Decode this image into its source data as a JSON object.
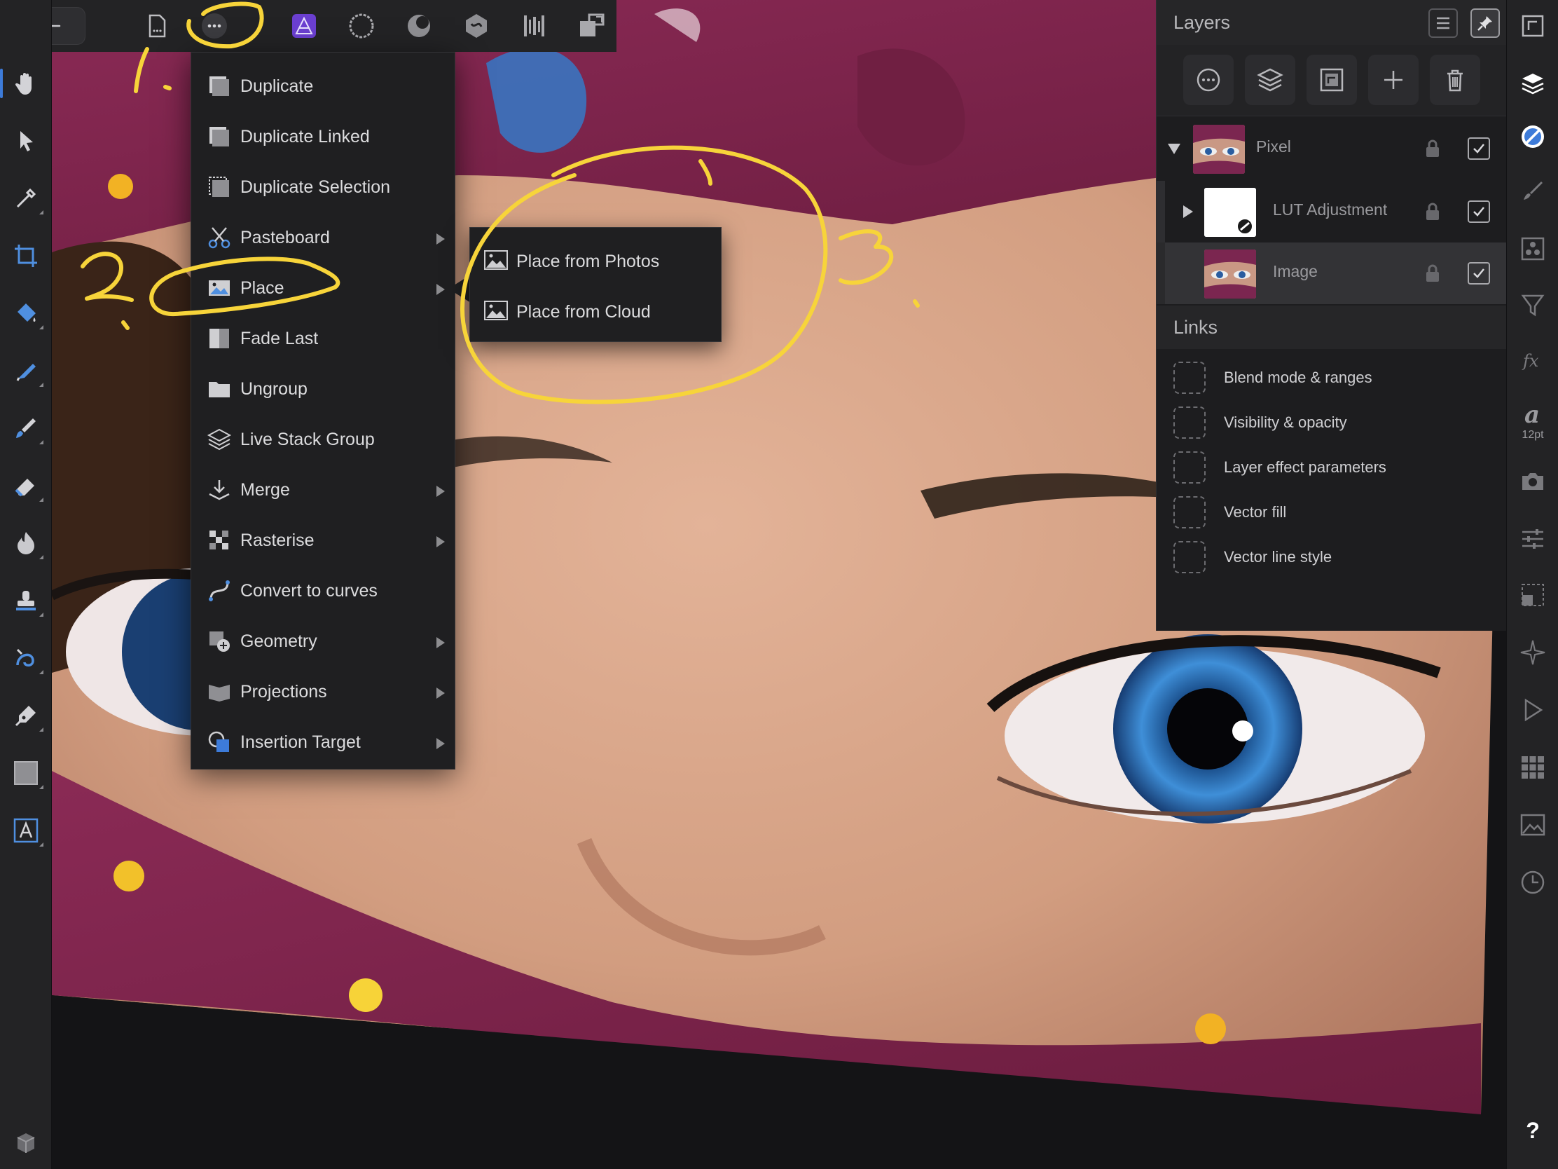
{
  "app": {
    "accent_color": "#3d7bd9",
    "annotation_color": "#f7d43a"
  },
  "top_toolbar": {
    "icons": [
      "back-arrow-icon",
      "document-icon",
      "more-options-icon",
      "photo-persona-icon",
      "liquify-persona-icon",
      "develop-persona-icon",
      "tone-mapping-persona-icon",
      "export-persona-icon",
      "layout-persona-icon"
    ]
  },
  "context_menu": {
    "items": [
      {
        "label": "Duplicate",
        "icon": "duplicate-icon",
        "submenu": false
      },
      {
        "label": "Duplicate Linked",
        "icon": "duplicate-linked-icon",
        "submenu": false
      },
      {
        "label": "Duplicate Selection",
        "icon": "duplicate-selection-icon",
        "submenu": false
      },
      {
        "label": "Pasteboard",
        "icon": "scissors-icon",
        "submenu": true
      },
      {
        "label": "Place",
        "icon": "place-image-icon",
        "submenu": true
      },
      {
        "label": "Fade Last",
        "icon": "fade-icon",
        "submenu": false
      },
      {
        "label": "Ungroup",
        "icon": "folder-icon",
        "submenu": false
      },
      {
        "label": "Live Stack Group",
        "icon": "stack-icon",
        "submenu": false
      },
      {
        "label": "Merge",
        "icon": "merge-icon",
        "submenu": true
      },
      {
        "label": "Rasterise",
        "icon": "rasterise-icon",
        "submenu": true
      },
      {
        "label": "Convert to curves",
        "icon": "curves-icon",
        "submenu": false
      },
      {
        "label": "Geometry",
        "icon": "geometry-icon",
        "submenu": true
      },
      {
        "label": "Projections",
        "icon": "projections-icon",
        "submenu": true
      },
      {
        "label": "Insertion Target",
        "icon": "insertion-target-icon",
        "submenu": true
      }
    ]
  },
  "submenu": {
    "items": [
      {
        "label": "Place from Photos",
        "icon": "image-icon"
      },
      {
        "label": "Place from Cloud",
        "icon": "image-icon"
      }
    ]
  },
  "layers_panel": {
    "title": "Layers",
    "actions": [
      "mask-icon",
      "layer-stack-icon",
      "adjustment-icon",
      "add-icon",
      "trash-icon"
    ],
    "layers": [
      {
        "name": "Pixel",
        "expanded": true,
        "locked": false,
        "visible": true
      },
      {
        "name": "LUT Adjustment",
        "expanded": false,
        "locked": false,
        "visible": true
      },
      {
        "name": "Image",
        "locked": false,
        "visible": true,
        "selected": true
      }
    ]
  },
  "links_panel": {
    "title": "Links",
    "items": [
      "Blend mode & ranges",
      "Visibility & opacity",
      "Layer effect parameters",
      "Vector fill",
      "Vector line style"
    ]
  },
  "right_toolbar": {
    "font_size": "12pt",
    "help": "?"
  },
  "annotations": {
    "step1": "1.",
    "step2": "2.",
    "step3": "3."
  }
}
